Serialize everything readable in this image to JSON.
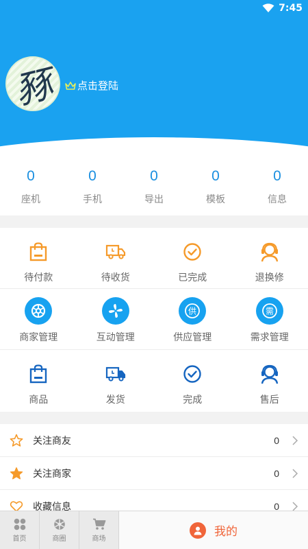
{
  "status_bar": {
    "time": "7:45"
  },
  "profile": {
    "avatar_text": "豩",
    "login_label": "点击登陆"
  },
  "stats": [
    {
      "value": "0",
      "label": "座机"
    },
    {
      "value": "0",
      "label": "手机"
    },
    {
      "value": "0",
      "label": "导出"
    },
    {
      "value": "0",
      "label": "模板"
    },
    {
      "value": "0",
      "label": "信息"
    }
  ],
  "orders": [
    {
      "label": "待付款",
      "icon": "shopping-bag-icon"
    },
    {
      "label": "待收货",
      "icon": "delivery-truck-icon"
    },
    {
      "label": "已完成",
      "icon": "check-circle-icon"
    },
    {
      "label": "退换修",
      "icon": "customer-service-icon"
    }
  ],
  "manage": [
    {
      "label": "商家管理",
      "icon": "aperture-icon"
    },
    {
      "label": "互动管理",
      "icon": "fan-icon"
    },
    {
      "label": "供应管理",
      "icon": "supply-icon",
      "glyph": "供"
    },
    {
      "label": "需求管理",
      "icon": "demand-icon",
      "glyph": "需"
    }
  ],
  "seller": [
    {
      "label": "商品",
      "icon": "shopping-bag-icon"
    },
    {
      "label": "发货",
      "icon": "delivery-truck-icon"
    },
    {
      "label": "完成",
      "icon": "check-circle-icon"
    },
    {
      "label": "售后",
      "icon": "customer-service-icon"
    }
  ],
  "list": [
    {
      "label": "关注商友",
      "count": "0",
      "icon": "star-outline-icon"
    },
    {
      "label": "关注商家",
      "count": "0",
      "icon": "star-filled-icon"
    },
    {
      "label": "收藏信息",
      "count": "0",
      "icon": "heart-outline-icon"
    }
  ],
  "bottom_nav": [
    {
      "label": "首页",
      "icon": "home-grid-icon"
    },
    {
      "label": "商圈",
      "icon": "aperture-icon"
    },
    {
      "label": "商场",
      "icon": "cart-icon"
    }
  ],
  "bottom_nav_active": {
    "label": "我的",
    "icon": "user-icon"
  },
  "colors": {
    "header_blue": "#1aa2f0",
    "orange": "#f59a2a",
    "dark_blue": "#1565c0",
    "active": "#f0653a"
  }
}
